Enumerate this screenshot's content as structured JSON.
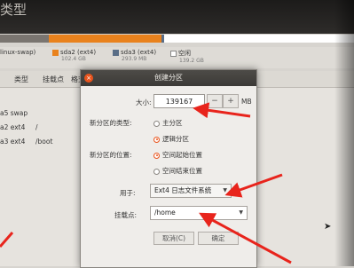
{
  "background": {
    "title_fragment": "类型"
  },
  "partitions": [
    {
      "name": "linux-swap)",
      "size": "",
      "color": "#7a7570"
    },
    {
      "name": "sda2 (ext4)",
      "size": "102.4 GB",
      "color": "#e9821d"
    },
    {
      "name": "sda3 (ext4)",
      "size": "293.9 MB",
      "color": "#5a6e87"
    },
    {
      "name": "空闲",
      "size": "139.2 GB",
      "color": "#ffffff"
    }
  ],
  "table": {
    "columns": [
      "类型",
      "挂载点",
      "格式"
    ],
    "rows": [
      {
        "device": "a5 swap",
        "mount": ""
      },
      {
        "device": "a2 ext4",
        "mount": "/"
      },
      {
        "device": "a3 ext4",
        "mount": "/boot"
      }
    ]
  },
  "dialog": {
    "title": "创建分区",
    "size_label": "大小:",
    "size_value": "139167",
    "size_unit": "MB",
    "minus": "−",
    "plus": "+",
    "type_label": "新分区的类型:",
    "type_options": [
      "主分区",
      "逻辑分区"
    ],
    "type_selected": "逻辑分区",
    "location_label": "新分区的位置:",
    "location_options": [
      "空间起始位置",
      "空间结束位置"
    ],
    "location_selected": "空间起始位置",
    "use_as_label": "用于:",
    "use_as_value": "Ext4 日志文件系统",
    "mount_label": "挂载点:",
    "mount_value": "/home",
    "cancel_label": "取消(C)",
    "ok_label": "确定"
  },
  "colors": {
    "accent": "#e9541d",
    "arrow": "#e8241c"
  }
}
